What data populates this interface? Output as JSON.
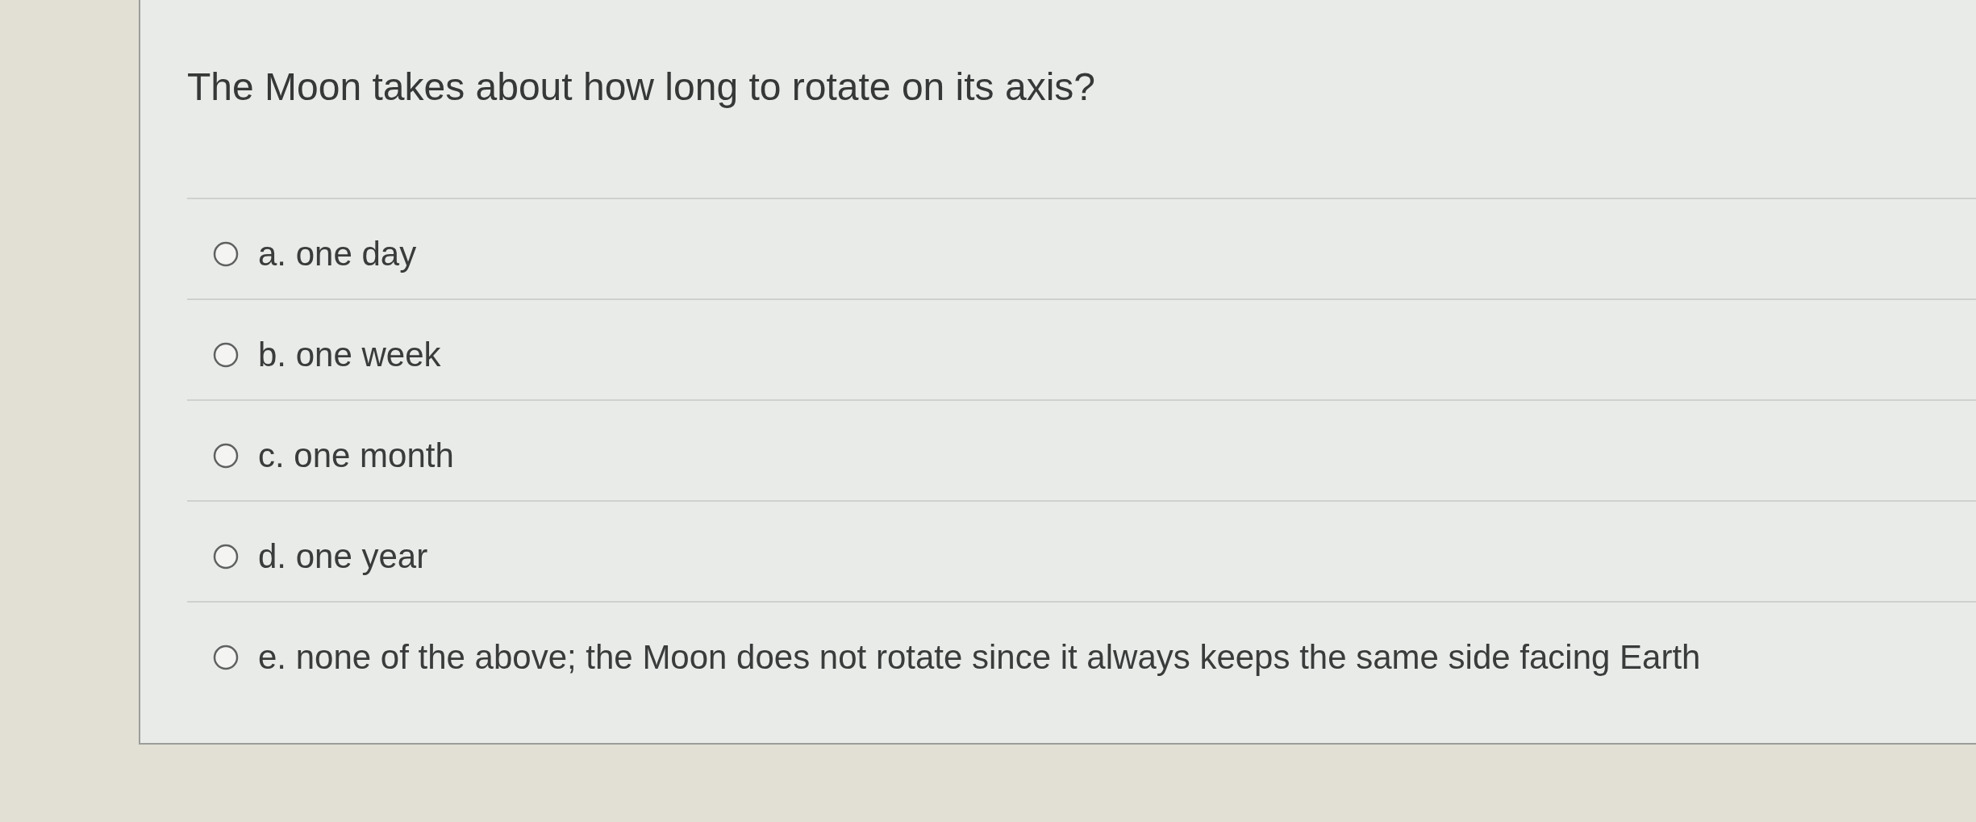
{
  "question": {
    "text": "The Moon takes about how long to rotate on its axis?"
  },
  "options": [
    {
      "label": "a. one day",
      "selected": false
    },
    {
      "label": "b. one week",
      "selected": false
    },
    {
      "label": "c. one month",
      "selected": false
    },
    {
      "label": "d. one year",
      "selected": false
    },
    {
      "label": "e. none of the above; the Moon does not rotate since it always keeps the same side facing Earth",
      "selected": false
    }
  ]
}
